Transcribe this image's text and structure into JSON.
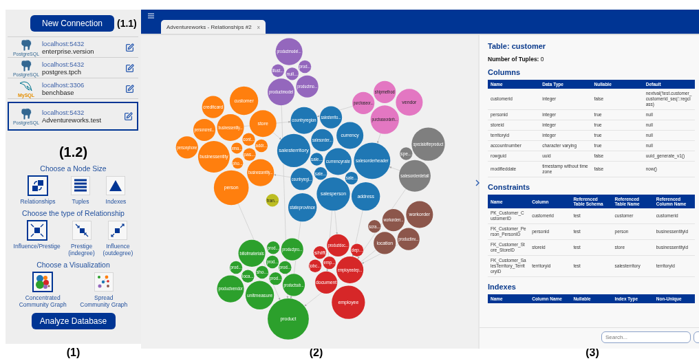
{
  "sidebar": {
    "new_connection_button": "New Connection",
    "annotation_top": "(1.1)",
    "connections": [
      {
        "kind": "postgresql",
        "logo_text": "PostgreSQL",
        "host": "localhost:5432",
        "database": "enterprise.version",
        "selected": false
      },
      {
        "kind": "postgresql",
        "logo_text": "PostgreSQL",
        "host": "localhost:5432",
        "database": "postgres.tpch",
        "selected": false
      },
      {
        "kind": "mysql",
        "logo_text": "MySQL",
        "host": "localhost:3306",
        "database": "benchbase",
        "selected": false
      },
      {
        "kind": "postgresql",
        "logo_text": "PostgreSQL",
        "host": "localhost:5432",
        "database": "Adventureworks.test",
        "selected": true
      }
    ],
    "annotation": "(1.2)",
    "sections": [
      {
        "title": "Choose a Node Size",
        "options": [
          {
            "kind": "relationships",
            "label": "Relationships",
            "selected": true
          },
          {
            "kind": "tuples",
            "label": "Tuples",
            "selected": false
          },
          {
            "kind": "indexes",
            "label": "Indexes",
            "selected": false
          }
        ]
      },
      {
        "title": "Choose the type of Relationship",
        "options": [
          {
            "kind": "influence_prestige",
            "label": "Influence/Prestige",
            "selected": true
          },
          {
            "kind": "prestige",
            "label": "Prestige\n(indegree)",
            "selected": false
          },
          {
            "kind": "influence",
            "label": "Influence\n(outdegree)",
            "selected": false
          }
        ]
      },
      {
        "title": "Choose a Visualization",
        "options": [
          {
            "kind": "concentrated",
            "label": "Concentrated\nCommunity Graph",
            "selected": true
          },
          {
            "kind": "spread",
            "label": "Spread\nCommunity Graph",
            "selected": false
          }
        ]
      }
    ],
    "analyze_button": "Analyze Database"
  },
  "tab": {
    "title": "Adventureworks - Relationships #2",
    "close": "x",
    "selected": true
  },
  "graph": {
    "nodes": [
      {
        "label": "productmodel...",
        "color": "#9467bd"
      },
      {
        "label": "illust...",
        "color": "#9467bd"
      },
      {
        "label": "null...",
        "color": "#9467bd"
      },
      {
        "label": "prod...",
        "color": "#9467bd"
      },
      {
        "label": "productmo...",
        "color": "#9467bd"
      },
      {
        "label": "productmodel",
        "color": "#9467bd"
      },
      {
        "label": "shipmethod",
        "color": "#e377c2"
      },
      {
        "label": "purchaseor...",
        "color": "#e377c2"
      },
      {
        "label": "vendor",
        "color": "#e377c2"
      },
      {
        "label": "purchaseorderh...",
        "color": "#e377c2"
      },
      {
        "label": "customer",
        "color": "#ff7f0e"
      },
      {
        "label": "creditcard",
        "color": "#ff7f0e"
      },
      {
        "label": "store",
        "color": "#ff7f0e"
      },
      {
        "label": "personcred...",
        "color": "#ff7f0e"
      },
      {
        "label": "businessentity...",
        "color": "#ff7f0e"
      },
      {
        "label": "personphone",
        "color": "#ff7f0e"
      },
      {
        "label": "businessentity",
        "color": "#ff7f0e"
      },
      {
        "label": "cont...",
        "color": "#ff7f0e"
      },
      {
        "label": "ema...",
        "color": "#ff7f0e"
      },
      {
        "label": "addr...",
        "color": "#ff7f0e"
      },
      {
        "label": "pas...",
        "color": "#ff7f0e"
      },
      {
        "label": "pho...",
        "color": "#ff7f0e"
      },
      {
        "label": "businessentity...",
        "color": "#ff7f0e"
      },
      {
        "label": "person",
        "color": "#ff7f0e"
      },
      {
        "label": "tran...",
        "color": "#bcbd22"
      },
      {
        "label": "countryregion",
        "color": "#1f77b4"
      },
      {
        "label": "salesterrito...",
        "color": "#1f77b4"
      },
      {
        "label": "currency",
        "color": "#1f77b4"
      },
      {
        "label": "salesorder...",
        "color": "#1f77b4"
      },
      {
        "label": "salesterritory",
        "color": "#1f77b4"
      },
      {
        "label": "sale...",
        "color": "#1f77b4"
      },
      {
        "label": "currencyrate",
        "color": "#1f77b4"
      },
      {
        "label": "salesorderheader",
        "color": "#1f77b4"
      },
      {
        "label": "sale...",
        "color": "#1f77b4"
      },
      {
        "label": "countryregi...",
        "color": "#1f77b4"
      },
      {
        "label": "sale...",
        "color": "#1f77b4"
      },
      {
        "label": "salesperson",
        "color": "#1f77b4"
      },
      {
        "label": "address",
        "color": "#1f77b4"
      },
      {
        "label": "stateprovince",
        "color": "#1f77b4"
      },
      {
        "label": "specialofferproduct",
        "color": "#7f7f7f"
      },
      {
        "label": "spe...",
        "color": "#7f7f7f"
      },
      {
        "label": "salesorderdetail",
        "color": "#7f7f7f"
      },
      {
        "label": "workorder",
        "color": "#8c564b"
      },
      {
        "label": "workorderr...",
        "color": "#8c564b"
      },
      {
        "label": "scra...",
        "color": "#8c564b"
      },
      {
        "label": "location",
        "color": "#8c564b"
      },
      {
        "label": "productinv...",
        "color": "#8c564b"
      },
      {
        "label": "billofmaterials",
        "color": "#2ca02c"
      },
      {
        "label": "prod...",
        "color": "#2ca02c"
      },
      {
        "label": "productpro...",
        "color": "#2ca02c"
      },
      {
        "label": "prod...",
        "color": "#2ca02c"
      },
      {
        "label": "prod...",
        "color": "#2ca02c"
      },
      {
        "label": "prod...",
        "color": "#2ca02c"
      },
      {
        "label": "loca...",
        "color": "#2ca02c"
      },
      {
        "label": "sho...",
        "color": "#2ca02c"
      },
      {
        "label": "prod...",
        "color": "#2ca02c"
      },
      {
        "label": "productsub...",
        "color": "#2ca02c"
      },
      {
        "label": "productvendor",
        "color": "#2ca02c"
      },
      {
        "label": "unitmeasure",
        "color": "#2ca02c"
      },
      {
        "label": "product",
        "color": "#2ca02c"
      },
      {
        "label": "productdoc...",
        "color": "#d62728"
      },
      {
        "label": "shift",
        "color": "#d62728"
      },
      {
        "label": "dep...",
        "color": "#d62728"
      },
      {
        "label": "jobc...",
        "color": "#d62728"
      },
      {
        "label": "emp...",
        "color": "#d62728"
      },
      {
        "label": "employeedep...",
        "color": "#d62728"
      },
      {
        "label": "document",
        "color": "#d62728"
      },
      {
        "label": "employee",
        "color": "#d62728"
      }
    ]
  },
  "panel": {
    "title": "Table: customer",
    "tuples": "**Number of Tuples:** 0",
    "sections": [
      {
        "heading": "Columns",
        "columns": [
          "Name",
          "Data Type",
          "Nullable",
          "Default"
        ],
        "rows": [
          [
            "customerid",
            "integer",
            "false",
            "nextval('test.customer_customerid_seq'::regclass)"
          ],
          [
            "personid",
            "integer",
            "true",
            "null"
          ],
          [
            "storeid",
            "integer",
            "true",
            "null"
          ],
          [
            "territoryid",
            "integer",
            "true",
            "null"
          ],
          [
            "accountnumber",
            "character varying",
            "true",
            "null"
          ],
          [
            "rowguid",
            "uuid",
            "false",
            "uuid_generate_v1()"
          ],
          [
            "modifieddate",
            "timestamp without time zone",
            "false",
            "now()"
          ]
        ]
      },
      {
        "heading": "Constraints",
        "columns": [
          "Name",
          "Column",
          "Referenced Table Schema",
          "Referenced Table Name",
          "Referenced Column Name"
        ],
        "rows": [
          [
            "PK_Customer_CustomerID",
            "customerid",
            "test",
            "customer",
            "customerid"
          ],
          [
            "FK_Customer_Person_PersonID",
            "personid",
            "test",
            "person",
            "businessentityid"
          ],
          [
            "FK_Customer_Store_StoreID",
            "storeid",
            "test",
            "store",
            "businessentityid"
          ],
          [
            "FK_Customer_SalesTerritory_TerritoryID",
            "territoryid",
            "test",
            "salesterritory",
            "territoryid"
          ]
        ]
      },
      {
        "heading": "Indexes",
        "columns": [
          "Name",
          "Column Name",
          "Nullable",
          "Index Type",
          "Non-Unique"
        ]
      }
    ],
    "search": {
      "placeholder": "Search..."
    }
  },
  "annotations": [
    "(1)",
    "(2)",
    "(3)"
  ]
}
